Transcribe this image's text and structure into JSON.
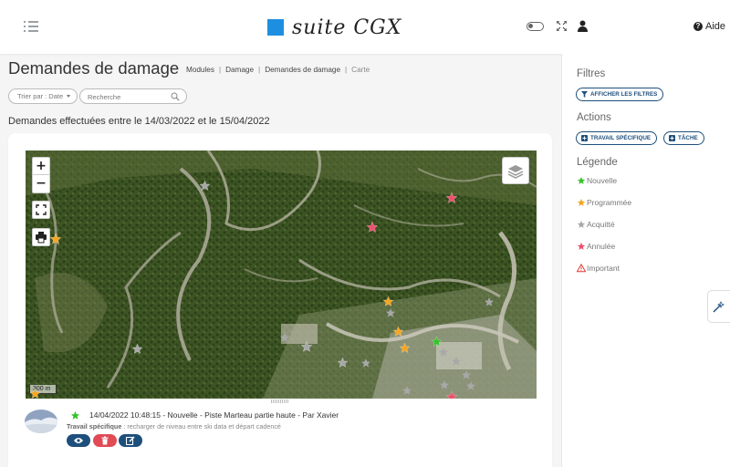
{
  "header": {
    "app_name": "suite CGX",
    "help_label": "Aide",
    "colors": {
      "logo_square": "#1e8fe0"
    }
  },
  "page": {
    "title": "Demandes de damage",
    "breadcrumb": [
      "Modules",
      "Damage",
      "Demandes de damage",
      "Carte"
    ]
  },
  "toolbar": {
    "sort_label": "Trier par : Date",
    "search_placeholder": "Recherche"
  },
  "date_range_text": "Demandes effectuées entre le 14/03/2022 et le 15/04/2022",
  "map": {
    "zoom_in_label": "+",
    "zoom_out_label": "−",
    "scale_label": "300 m",
    "markers": [
      {
        "status": "programmee"
      },
      {
        "status": "annulee"
      },
      {
        "status": "annulee"
      },
      {
        "status": "acquitte"
      },
      {
        "status": "programmee"
      },
      {
        "status": "programmee"
      },
      {
        "status": "programmee"
      },
      {
        "status": "nouvelle"
      },
      {
        "status": "programmee"
      },
      {
        "status": "acquitte"
      },
      {
        "status": "acquitte"
      },
      {
        "status": "acquitte"
      },
      {
        "status": "annulee"
      }
    ]
  },
  "entries": [
    {
      "status": "nouvelle",
      "title": "14/04/2022 10:48:15 - Nouvelle - Piste Marteau partie haute - Par Xavier",
      "type_label": "Travail spécifique",
      "description": " : recharger de niveau entre ski data et départ cadencé"
    }
  ],
  "panel": {
    "filters_heading": "Filtres",
    "show_filters_label": "AFFICHER LES FILTRES",
    "actions_heading": "Actions",
    "action_specific_label": "TRAVAIL SPÉCIFIQUE",
    "action_task_label": "TÂCHE",
    "legend_heading": "Légende",
    "legend": [
      {
        "key": "nouvelle",
        "label": "Nouvelle",
        "icon": "star-icon",
        "color": "#35c42b"
      },
      {
        "key": "programmee",
        "label": "Programmée",
        "icon": "star-icon",
        "color": "#f5a623"
      },
      {
        "key": "acquitte",
        "label": "Acquitté",
        "icon": "star-icon",
        "color": "#a8a8a8"
      },
      {
        "key": "annulee",
        "label": "Annulée",
        "icon": "star-icon",
        "color": "#f0506e"
      },
      {
        "key": "important",
        "label": "Important",
        "icon": "warning-icon",
        "color": "#e53935"
      }
    ]
  },
  "colors": {
    "primary": "#1e4f7c",
    "danger": "#e04b55"
  }
}
